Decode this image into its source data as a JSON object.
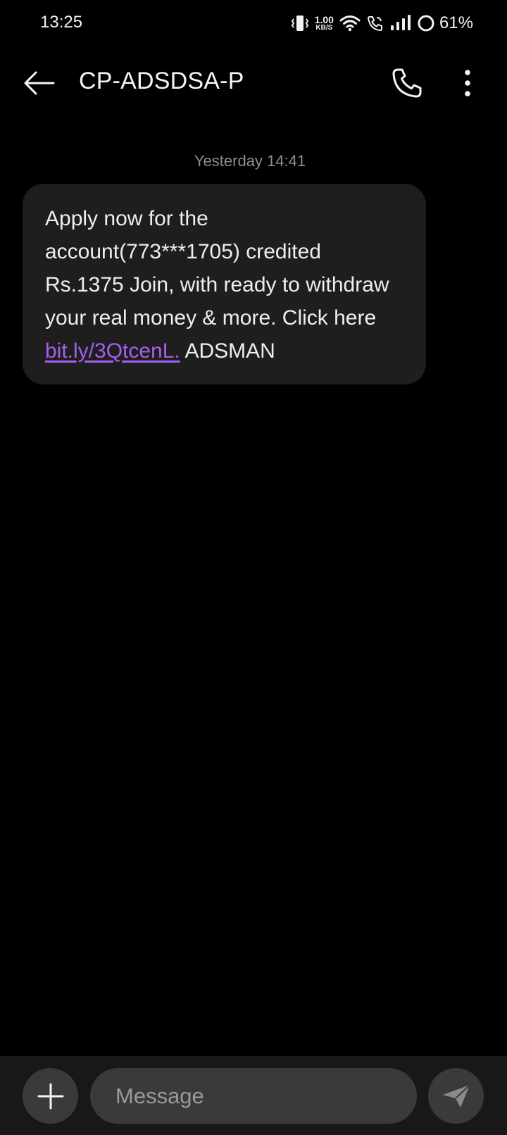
{
  "status_bar": {
    "time": "13:25",
    "net_speed_value": "1.00",
    "net_speed_unit": "KB/S",
    "battery_percent": "61%",
    "icons": [
      "vibrate-icon",
      "wifi-icon",
      "wifi-calling-icon",
      "signal-icon",
      "battery-ring-icon"
    ]
  },
  "app_bar": {
    "title": "CP-ADSDSA-P",
    "icons": [
      "back-arrow-icon",
      "phone-icon",
      "more-vert-icon"
    ]
  },
  "conversation": {
    "timestamp": "Yesterday 14:41",
    "message": {
      "text": "Apply now for the account(773***1705) credited Rs.1375 Join, with ready to withdraw your real money & more. Click here ",
      "link": "bit.ly/3QtcenL.",
      "suffix": " ADSMAN"
    }
  },
  "compose": {
    "placeholder": "Message",
    "icons": [
      "plus-icon",
      "send-icon"
    ]
  },
  "colors": {
    "background": "#000000",
    "bubble": "#1e1e1e",
    "link": "#a45ef0",
    "compose_bar": "#181818",
    "control": "#3a3a3a"
  }
}
